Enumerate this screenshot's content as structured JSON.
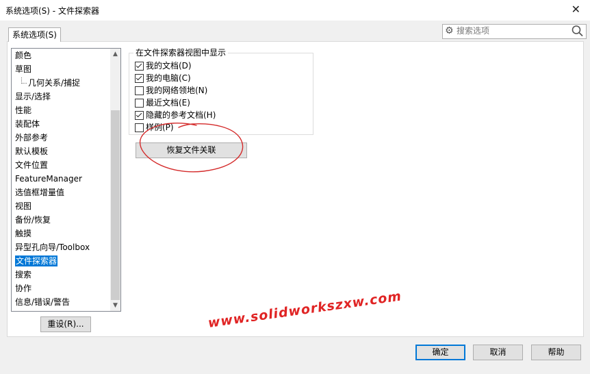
{
  "window": {
    "title": "系统选项(S) - 文件探索器"
  },
  "tab": {
    "label": "系统选项(S)"
  },
  "search": {
    "placeholder": "搜索选项"
  },
  "categories": [
    {
      "label": "颜色",
      "level": 0
    },
    {
      "label": "草图",
      "level": 0
    },
    {
      "label": "几何关系/捕捉",
      "level": 1
    },
    {
      "label": "显示/选择",
      "level": 0
    },
    {
      "label": "性能",
      "level": 0
    },
    {
      "label": "装配体",
      "level": 0
    },
    {
      "label": "外部参考",
      "level": 0
    },
    {
      "label": "默认模板",
      "level": 0
    },
    {
      "label": "文件位置",
      "level": 0
    },
    {
      "label": "FeatureManager",
      "level": 0
    },
    {
      "label": "选值框增量值",
      "level": 0
    },
    {
      "label": "视图",
      "level": 0
    },
    {
      "label": "备份/恢复",
      "level": 0
    },
    {
      "label": "触摸",
      "level": 0
    },
    {
      "label": "异型孔向导/Toolbox",
      "level": 0
    },
    {
      "label": "文件探索器",
      "level": 0,
      "selected": true
    },
    {
      "label": "搜索",
      "level": 0
    },
    {
      "label": "协作",
      "level": 0
    },
    {
      "label": "信息/错误/警告",
      "level": 0
    }
  ],
  "reset_label": "重设(R)...",
  "group": {
    "title": "在文件探索器视图中显示",
    "options": [
      {
        "label": "我的文档(D)",
        "checked": true
      },
      {
        "label": "我的电脑(C)",
        "checked": true
      },
      {
        "label": "我的网络领地(N)",
        "checked": false
      },
      {
        "label": "最近文档(E)",
        "checked": false
      },
      {
        "label": "隐藏的参考文档(H)",
        "checked": true
      },
      {
        "label": "样例(P)",
        "checked": false
      }
    ]
  },
  "restore_label": "恢复文件关联",
  "buttons": {
    "ok": "确定",
    "cancel": "取消",
    "help": "帮助"
  },
  "watermark": "www.solidworkszxw.com",
  "colors": {
    "accent": "#0078d7",
    "annotation": "#d42a2a"
  }
}
